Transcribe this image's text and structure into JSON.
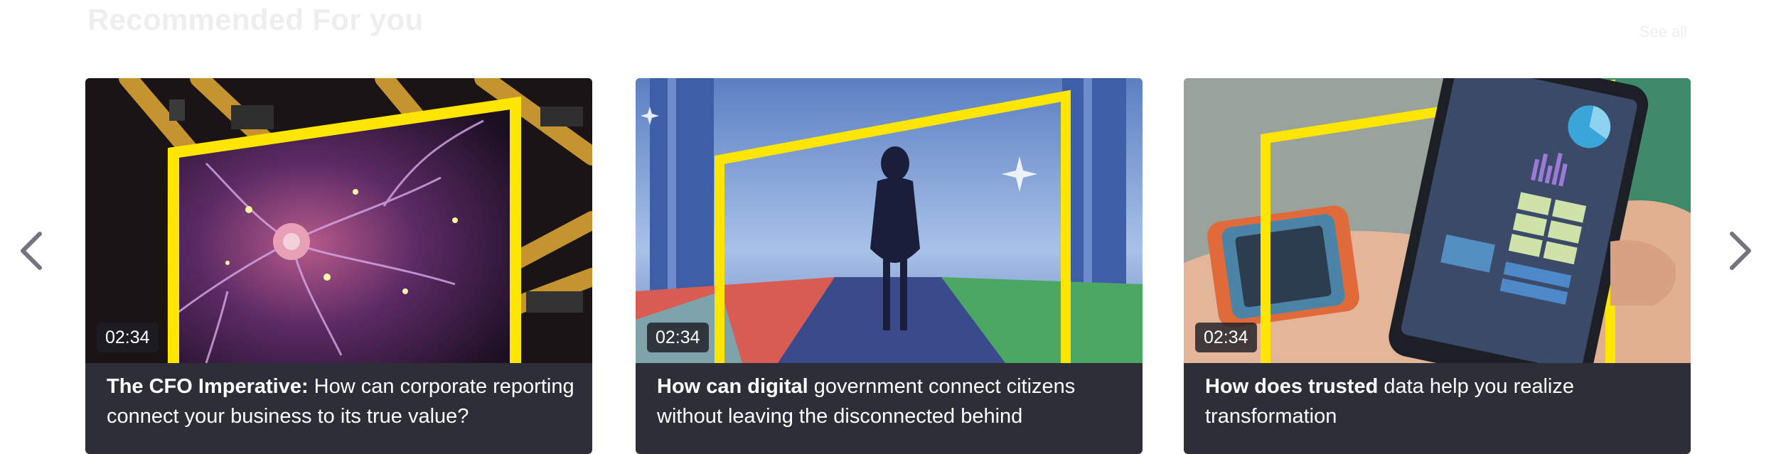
{
  "section": {
    "title": "Recommended For you",
    "see_all_label": "See all"
  },
  "carousel": {
    "prev_icon": "chevron-left-icon",
    "next_icon": "chevron-right-icon",
    "arrow_color": "#747480"
  },
  "cards": [
    {
      "duration": "02:34",
      "title_bold": "The CFO Imperative:",
      "title_rest": " How can corporate reporting connect your business to its true value?",
      "thumbnail": "neuron-network-illustration"
    },
    {
      "duration": "02:34",
      "title_bold": "How can digital",
      "title_rest": " government connect citizens without leaving the disconnected behind",
      "thumbnail": "woman-silhouette-digital-hall-illustration"
    },
    {
      "duration": "02:34",
      "title_bold": "How does trusted",
      "title_rest": " data help you realize transformation",
      "thumbnail": "smartwatch-and-phone-data-photo"
    }
  ],
  "colors": {
    "accent_yellow": "#ffe600",
    "card_bg": "#2e2e38"
  }
}
